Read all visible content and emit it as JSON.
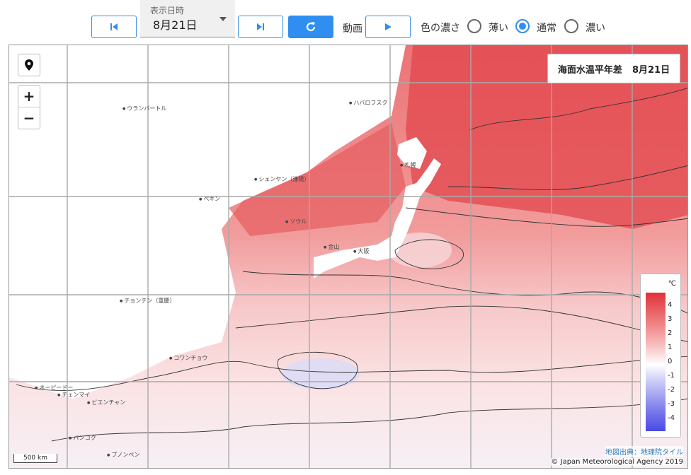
{
  "controls": {
    "date_label": "表示日時",
    "date_value": "8月21日",
    "animation_label": "動画",
    "density_label": "色の濃さ",
    "density_options": [
      "薄い",
      "通常",
      "濃い"
    ],
    "density_selected": "通常"
  },
  "map": {
    "title": "海面水温平年差",
    "title_date": "8月21日",
    "legend": {
      "unit": "℃",
      "ticks": [
        "4",
        "3",
        "2",
        "1",
        "0",
        "-1",
        "-2",
        "-3",
        "-4"
      ]
    },
    "scale_label": "500 km",
    "attribution_link": "地図出典：地理院タイル",
    "copyright": "© Japan Meteorological Agency 2019",
    "cities": [
      "ウランバートル",
      "ハバロフスク",
      "シェンヤン（瀋陽）",
      "ペキン",
      "札幌",
      "ソウル",
      "金山",
      "大阪",
      "チョンチン（重慶）",
      "コワンチョウ",
      "ネーピードー",
      "チェンマイ",
      "ビエンチャン",
      "バンコク",
      "プノンペン"
    ]
  }
}
